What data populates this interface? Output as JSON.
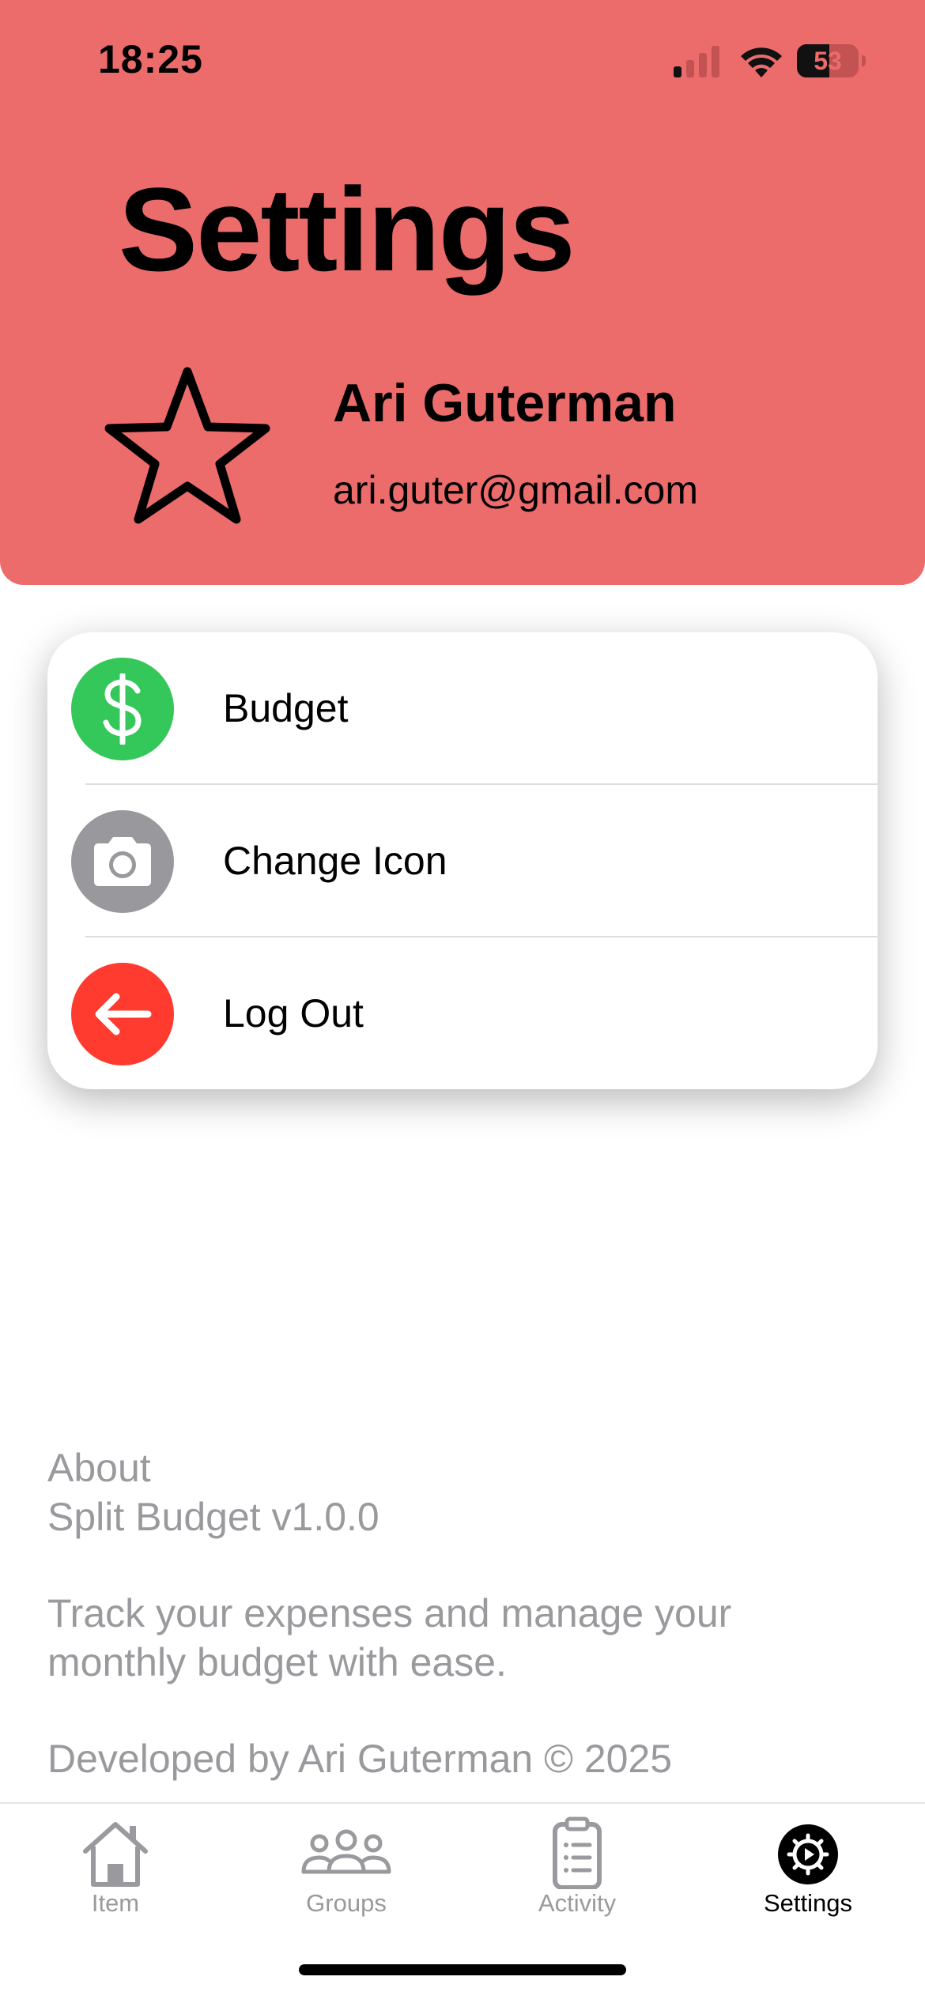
{
  "status_bar": {
    "time": "18:25",
    "battery_percent": "53",
    "battery_level": 0.53
  },
  "header": {
    "title": "Settings",
    "user_name": "Ari Guterman",
    "user_email": "ari.guter@gmail.com",
    "background_color": "#ec6b6b",
    "avatar_icon": "star-outline-icon"
  },
  "menu": {
    "items": [
      {
        "label": "Budget",
        "icon": "dollar-icon",
        "color": "#34c759"
      },
      {
        "label": "Change Icon",
        "icon": "camera-icon",
        "color": "#98989d"
      },
      {
        "label": "Log Out",
        "icon": "arrow-left-icon",
        "color": "#ff3b30"
      }
    ]
  },
  "about": {
    "heading": "About",
    "version": "Split Budget v1.0.0",
    "description": "Track your expenses and manage your monthly budget with ease.",
    "credit": "Developed by Ari Guterman © 2025"
  },
  "tabbar": {
    "tabs": [
      {
        "label": "Item",
        "icon": "house-icon"
      },
      {
        "label": "Groups",
        "icon": "people-icon"
      },
      {
        "label": "Activity",
        "icon": "clipboard-icon"
      },
      {
        "label": "Settings",
        "icon": "gear-icon",
        "active": true
      }
    ]
  }
}
